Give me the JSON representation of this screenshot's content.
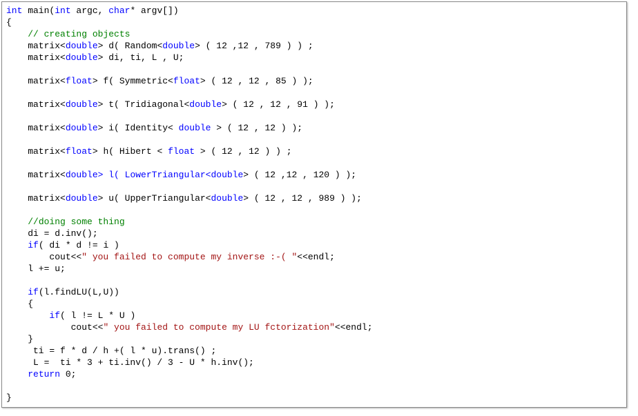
{
  "code": {
    "l1": {
      "kw_int": "int",
      "fn": " main(",
      "kw_int2": "int",
      "args": " argc, ",
      "kw_char": "char",
      "rest": "* argv[])"
    },
    "l2": "{",
    "l3": {
      "ind": "    ",
      "cm": "// creating objects"
    },
    "l4": {
      "ind": "    matrix<",
      "kw": "double",
      "mid": "> d( Random<",
      "kw2": "double",
      "rest": "> ( 12 ,12 , 789 ) ) ;"
    },
    "l5": {
      "ind": "    matrix<",
      "kw": "double",
      "rest": "> di, ti, L , U;"
    },
    "l6": "",
    "l7": {
      "ind": "    matrix<",
      "kw": "float",
      "mid": "> f( Symmetric<",
      "kw2": "float",
      "rest": "> ( 12 , 12 , 85 ) );"
    },
    "l8": "",
    "l9": {
      "ind": "    matrix<",
      "kw": "double",
      "mid": "> t( Tridiagonal<",
      "kw2": "double",
      "rest": "> ( 12 , 12 , 91 ) );"
    },
    "l10": "",
    "l11": {
      "ind": "    matrix<",
      "kw": "double",
      "mid": "> i( Identity< ",
      "kw2": "double",
      "rest": " > ( 12 , 12 ) );"
    },
    "l12": "",
    "l13": {
      "ind": "    matrix<",
      "kw": "float",
      "mid": "> h( Hibert < ",
      "kw2": "float",
      "rest": " > ( 12 , 12 ) ) ;"
    },
    "l14": "",
    "l15": {
      "ind": "    matrix<",
      "kw": "double",
      "mid": "> l( LowerTriangular<",
      "kw2": "double",
      "rest": "> ( 12 ,12 , 120 ) );"
    },
    "l16": "",
    "l17": {
      "ind": "    matrix<",
      "kw": "double",
      "mid": "> u( UpperTriangular<",
      "kw2": "double",
      "rest": "> ( 12 , 12 , 989 ) );"
    },
    "l18": "",
    "l19": {
      "ind": "    ",
      "cm": "//doing some thing"
    },
    "l20": "    di = d.inv();",
    "l21": {
      "ind": "    ",
      "kw": "if",
      "rest": "( di * d != i )"
    },
    "l22": {
      "ind": "        cout<<",
      "str": "\" you failed to compute my inverse :-( \"",
      "rest": "<<endl;"
    },
    "l23": "    l += u;",
    "l24": "",
    "l25": {
      "ind": "    ",
      "kw": "if",
      "rest": "(l.findLU(L,U))"
    },
    "l26": "    {",
    "l27": {
      "ind": "        ",
      "kw": "if",
      "rest": "( l != L * U )"
    },
    "l28": {
      "ind": "            cout<<",
      "str": "\" you failed to compute my LU fctorization\"",
      "rest": "<<endl;"
    },
    "l29": "    }",
    "l30": "     ti = f * d / h +( l * u).trans() ;",
    "l31": "     L =  ti * 3 + ti.inv() / 3 - U * h.inv();",
    "l32": {
      "ind": "    ",
      "kw": "return",
      "rest": " 0;"
    },
    "l33": "",
    "l34": "}"
  }
}
